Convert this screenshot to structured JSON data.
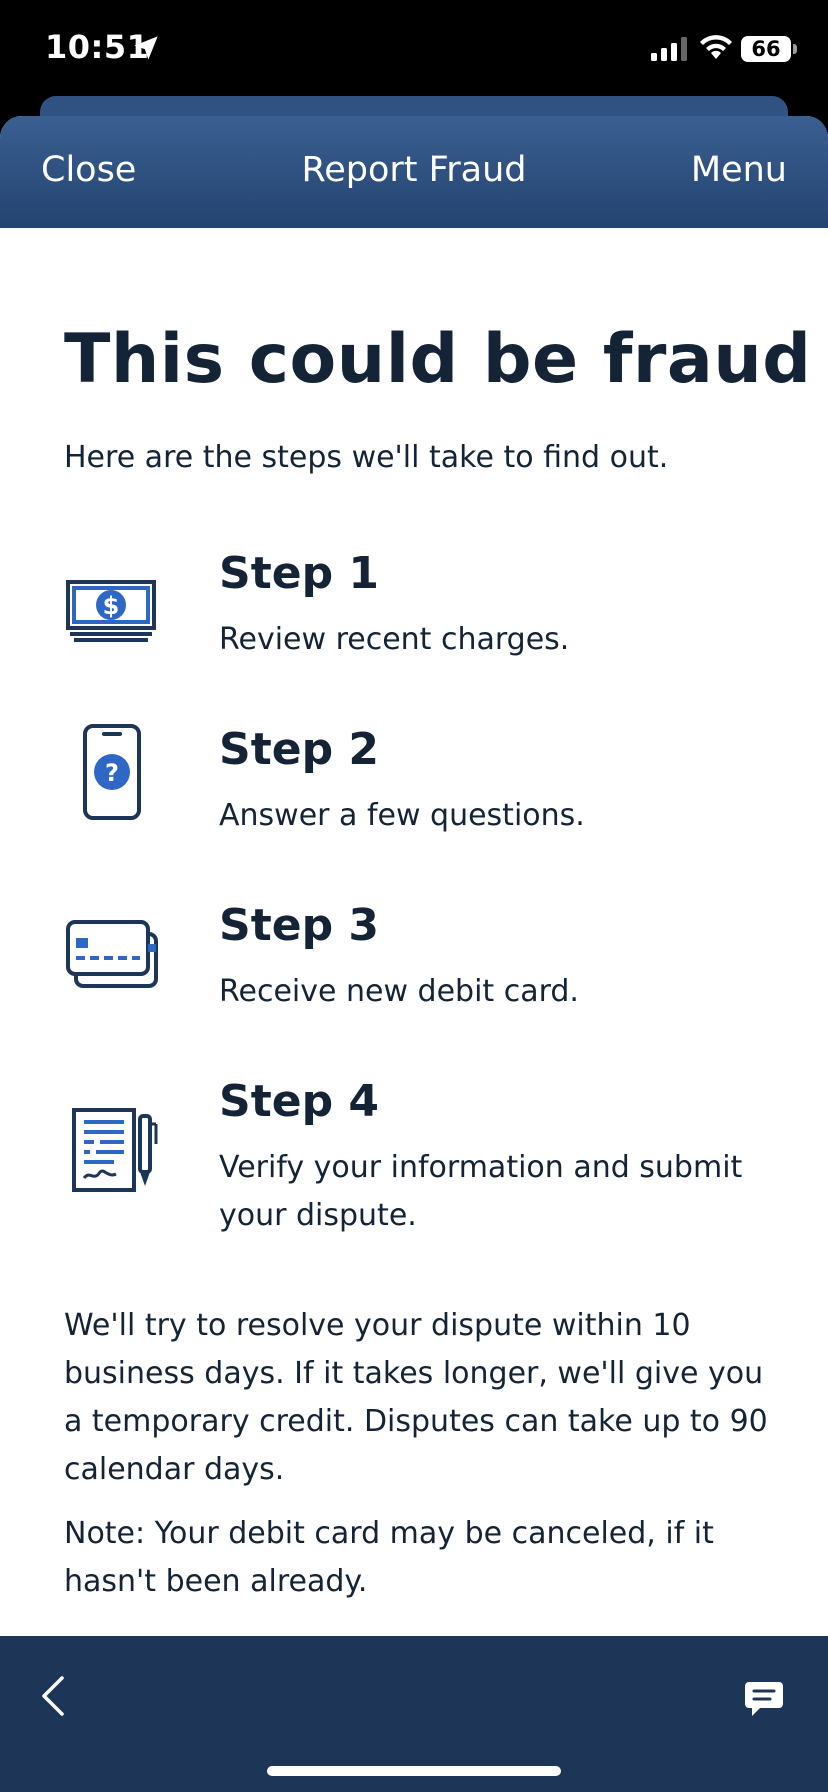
{
  "status_bar": {
    "time": "10:51",
    "battery": "66",
    "icons": [
      "location-arrow-icon",
      "cellular-signal-icon",
      "wifi-icon",
      "battery-icon"
    ]
  },
  "nav": {
    "close_label": "Close",
    "title": "Report Fraud",
    "menu_label": "Menu"
  },
  "main": {
    "title": "This could be fraud",
    "subtitle": "Here are the steps we'll take to find out.",
    "steps": [
      {
        "title": "Step 1",
        "description": "Review recent charges.",
        "icon": "cash-icon"
      },
      {
        "title": "Step 2",
        "description": "Answer a few questions.",
        "icon": "phone-question-icon"
      },
      {
        "title": "Step 3",
        "description": "Receive new debit card.",
        "icon": "cards-icon"
      },
      {
        "title": "Step 4",
        "description": "Verify your information and submit your dispute.",
        "icon": "document-pen-icon"
      }
    ],
    "resolution_text": "We'll try to resolve your dispute within 10 business days. If it takes longer, we'll give you a temporary credit. Disputes can take up to 90 calendar days.",
    "note_text": "Note: Your debit card may be canceled, if it hasn't been already."
  },
  "bottom_bar": {
    "icons": [
      "back-chevron-icon",
      "chat-icon"
    ]
  },
  "colors": {
    "nav_gradient_top": "#3a5f91",
    "nav_gradient_bottom": "#244470",
    "bottom_bar": "#1d3557",
    "text_dark": "#142436",
    "icon_blue": "#2f68c4",
    "icon_navy": "#1d3557"
  }
}
